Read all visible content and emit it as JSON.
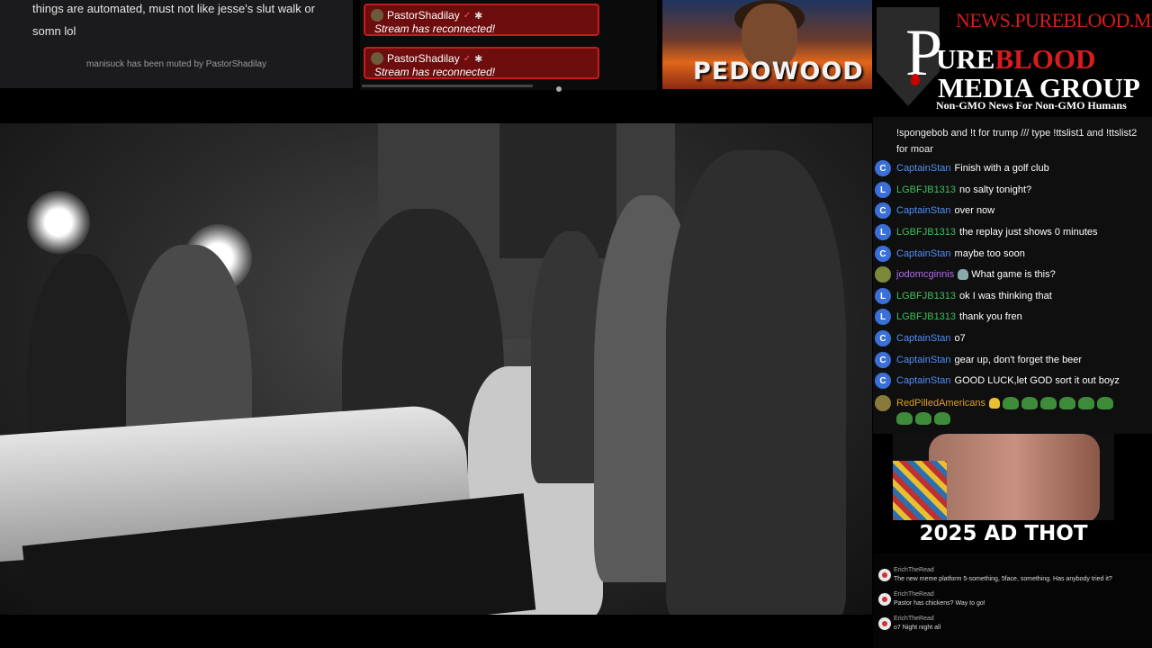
{
  "top_chat": {
    "message": "things are automated, must not like jesse's slut walk or somn lol",
    "system_notice": "manisuck has been muted by PastorShadilay"
  },
  "alerts": [
    {
      "user": "PastorShadilay",
      "text": "Stream has reconnected!"
    },
    {
      "user": "PastorShadilay",
      "text": "Stream has reconnected!"
    }
  ],
  "thumbnail": {
    "caption": "PEDOWOOD"
  },
  "logo": {
    "url": "NEWS.PUREBLOOD.MEDIA",
    "cross_letter": "P",
    "word_pure": "URE",
    "word_blood": "BLOOD",
    "line2": "MEDIA GROUP",
    "tagline": "Non-GMO News For Non-GMO Humans"
  },
  "chat": {
    "info": "!spongebob and !t for trump /// type !ttslist1 and !ttslist2 for moar",
    "messages": [
      {
        "initial": "C",
        "name": "CaptainStan",
        "text": "Finish with a golf club"
      },
      {
        "initial": "L",
        "name": "LGBFJB1313",
        "text": "no salty tonight?"
      },
      {
        "initial": "C",
        "name": "CaptainStan",
        "text": "over now"
      },
      {
        "initial": "L",
        "name": "LGBFJB1313",
        "text": "the replay just shows 0 minutes"
      },
      {
        "initial": "C",
        "name": "CaptainStan",
        "text": "maybe too soon"
      },
      {
        "initial": "",
        "name": "jodomcginnis",
        "text": "What game is this?"
      },
      {
        "initial": "L",
        "name": "LGBFJB1313",
        "text": "ok I was thinking that"
      },
      {
        "initial": "L",
        "name": "LGBFJB1313",
        "text": "thank you fren"
      },
      {
        "initial": "C",
        "name": "CaptainStan",
        "text": "o7"
      },
      {
        "initial": "C",
        "name": "CaptainStan",
        "text": "gear up, don't forget the beer"
      },
      {
        "initial": "C",
        "name": "CaptainStan",
        "text": "GOOD LUCK,let GOD sort it out boyz"
      },
      {
        "initial": "",
        "name": "RedPilledAmericans",
        "text": ""
      }
    ]
  },
  "ad": {
    "caption": "2025 AD THOT"
  },
  "mini_chat": [
    {
      "name": "ErichTheRead",
      "text": "The new meme platform 5-something, 5face, something. Has anybody tried it?"
    },
    {
      "name": "ErichTheRead",
      "text": "Pastor has chickens? Way to go!"
    },
    {
      "name": "ErichTheRead",
      "text": "o7 Night night all"
    }
  ],
  "colors": {
    "captainstan": "#4f8ff7",
    "lgbfjb": "#3fbf5a",
    "jodomcginnis": "#b36bf2",
    "redpilled": "#d9a021",
    "alert_bg": "#6e0d0d",
    "alert_border": "#c41c1c",
    "logo_red": "#d71c1c"
  }
}
